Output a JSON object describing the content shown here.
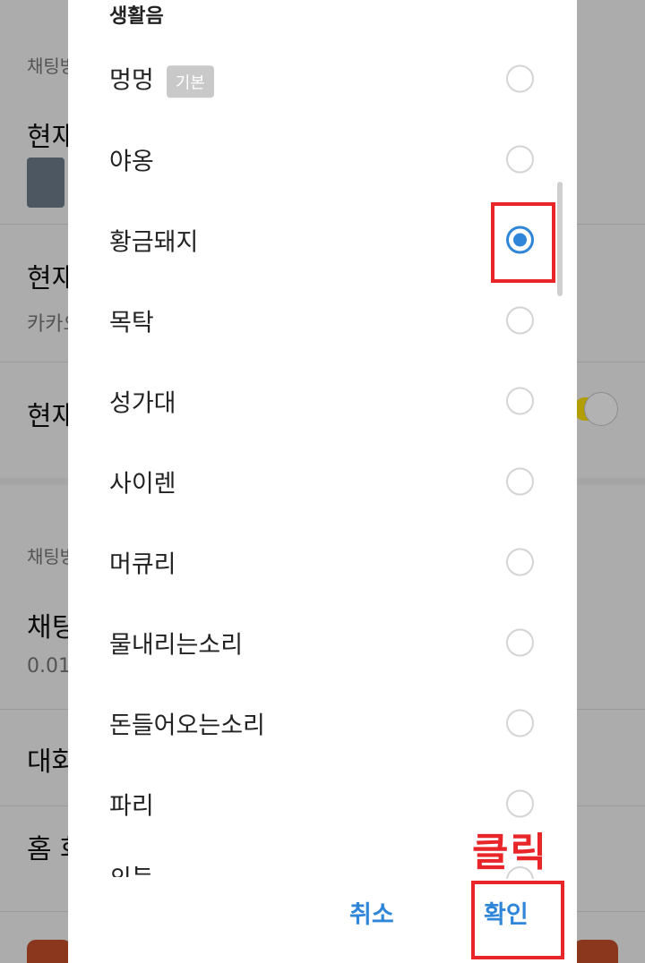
{
  "background": {
    "section1_label": "채팅방",
    "row1_title": "현재",
    "row2_title": "현재",
    "row2_sub": "카카오",
    "row3_title": "현재",
    "section2_label": "채팅방",
    "row4_title": "채팅",
    "row4_sub": "0.01",
    "row5_title": "대화",
    "row6_title": "홈 화"
  },
  "dialog": {
    "header": "생활음",
    "options": [
      {
        "label": "멍멍",
        "badge": "기본",
        "selected": false
      },
      {
        "label": "야옹",
        "selected": false
      },
      {
        "label": "황금돼지",
        "selected": true
      },
      {
        "label": "목탁",
        "selected": false
      },
      {
        "label": "성가대",
        "selected": false
      },
      {
        "label": "사이렌",
        "selected": false
      },
      {
        "label": "머큐리",
        "selected": false
      },
      {
        "label": "물내리는소리",
        "selected": false
      },
      {
        "label": "돈들어오는소리",
        "selected": false
      },
      {
        "label": "파리",
        "selected": false
      },
      {
        "label": "히트",
        "selected": false
      }
    ],
    "cancel_label": "취소",
    "confirm_label": "확인"
  },
  "annotation": {
    "click_label": "클릭",
    "color": "#e8262a"
  },
  "colors": {
    "accent": "#2f86d8",
    "toggle": "#ffe300"
  }
}
